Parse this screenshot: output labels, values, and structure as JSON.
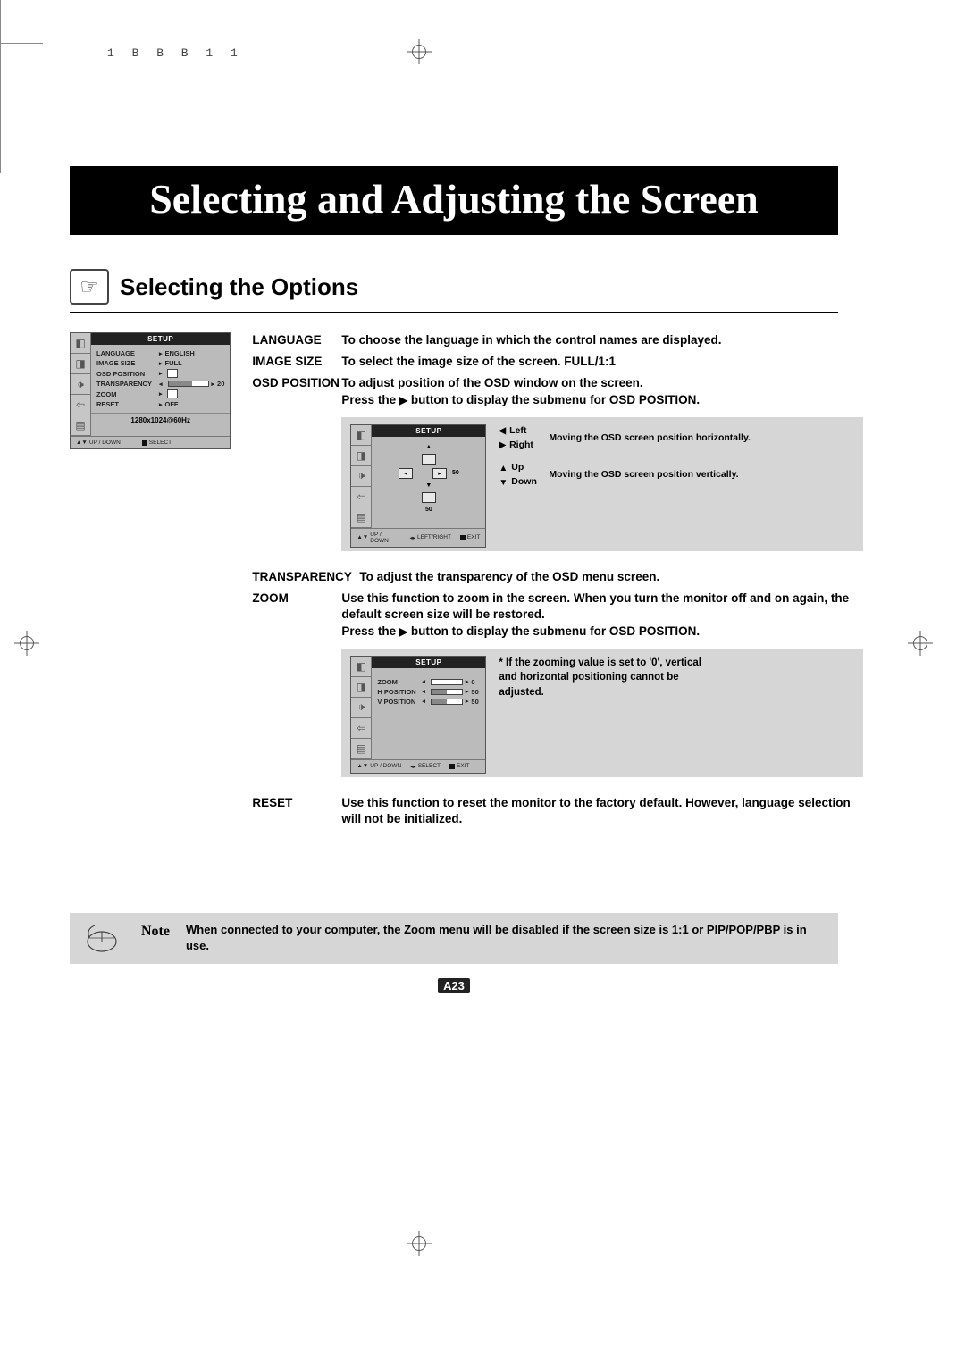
{
  "header_meta": "1  B        B  B       1         1",
  "title": "Selecting and Adjusting the Screen",
  "section_title": "Selecting the Options",
  "osd1": {
    "title": "SETUP",
    "items": [
      {
        "label": "LANGUAGE",
        "value": "ENGLISH"
      },
      {
        "label": "IMAGE SIZE",
        "value": "FULL"
      },
      {
        "label": "OSD POSITION",
        "value": ""
      },
      {
        "label": "TRANSPARENCY",
        "slider": 60,
        "num": "20"
      },
      {
        "label": "ZOOM",
        "value": ""
      },
      {
        "label": "RESET",
        "value": "OFF"
      }
    ],
    "status": "1280x1024@60Hz",
    "footer_left": "UP / DOWN",
    "footer_right": "SELECT"
  },
  "defs": {
    "language": {
      "key": "LANGUAGE",
      "val": "To choose the language in which the control names are displayed."
    },
    "image_size": {
      "key": "IMAGE SIZE",
      "val": "To select the image size of the screen. FULL/1:1"
    },
    "osd_position": {
      "key": "OSD POSITION",
      "val1": "To adjust position of the OSD window on the screen.",
      "val2a": "Press the ",
      "val2b": " button to display the submenu for OSD POSITION."
    },
    "transparency": {
      "key": "TRANSPARENCY",
      "val": "To adjust the transparency of the OSD menu screen."
    },
    "zoom": {
      "key": "ZOOM",
      "val1": "Use this function to zoom in the screen. When you turn the monitor off and on again, the default screen size will be restored.",
      "val2a": "Press the ",
      "val2b": " button to display the submenu for OSD POSITION."
    },
    "reset": {
      "key": "RESET",
      "val": "Use this function to reset the monitor to the factory default. However, language selection will not be initialized."
    }
  },
  "position_panel": {
    "title": "SETUP",
    "val_h": "50",
    "val_v": "50",
    "footer": {
      "updown": "UP / DOWN",
      "lr": "LEFT/RIGHT",
      "exit": "EXIT"
    },
    "dirs": {
      "left": "Left",
      "right": "Right",
      "up": "Up",
      "down": "Down",
      "horiz": "Moving the OSD screen position horizontally.",
      "vert": "Moving the OSD screen position vertically."
    }
  },
  "zoom_panel": {
    "title": "SETUP",
    "rows": [
      {
        "label": "ZOOM",
        "num": "0"
      },
      {
        "label": "H POSITION",
        "num": "50"
      },
      {
        "label": "V POSITION",
        "num": "50"
      }
    ],
    "footer": {
      "updown": "UP / DOWN",
      "sel": "SELECT",
      "exit": "EXIT"
    },
    "note": "* If the zooming value is set to '0', vertical and horizontal positioning cannot be adjusted."
  },
  "note": {
    "label": "Note",
    "text": "When connected to your computer, the Zoom menu will be disabled if the screen size is 1:1 or PIP/POP/PBP is in use."
  },
  "page_number": "A23"
}
